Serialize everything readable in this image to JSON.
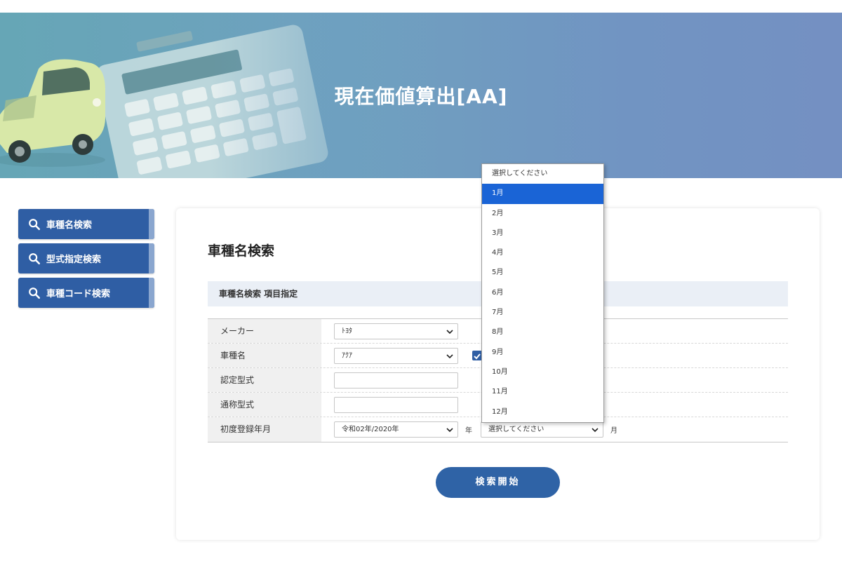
{
  "hero": {
    "title": "現在価値算出[AA]"
  },
  "side_menu": {
    "items": [
      {
        "label": "車種名検索"
      },
      {
        "label": "型式指定検索"
      },
      {
        "label": "車種コード検索"
      }
    ]
  },
  "main": {
    "section_title": "車種名検索",
    "sub_title": "車種名検索 項目指定",
    "rows": {
      "maker": {
        "label": "メーカー",
        "value": "ﾄﾖﾀ"
      },
      "model": {
        "label": "車種名",
        "value": "ｱｸｱ"
      },
      "cert_type": {
        "label": "認定型式",
        "value": ""
      },
      "common_type": {
        "label": "通称型式",
        "value": ""
      },
      "first_reg": {
        "label": "初度登録年月",
        "year_value": "令和02年/2020年",
        "year_unit": "年",
        "month_value": "選択してください",
        "month_unit": "月"
      }
    },
    "search_button": "検索開始"
  },
  "month_dropdown": {
    "options": [
      "選択してください",
      "1月",
      "2月",
      "3月",
      "4月",
      "5月",
      "6月",
      "7月",
      "8月",
      "9月",
      "10月",
      "11月",
      "12月"
    ],
    "highlighted_index": 1
  },
  "colors": {
    "primary": "#2f5ea4",
    "highlight": "#1a64d6",
    "sub_bar": "#eaeff6"
  }
}
